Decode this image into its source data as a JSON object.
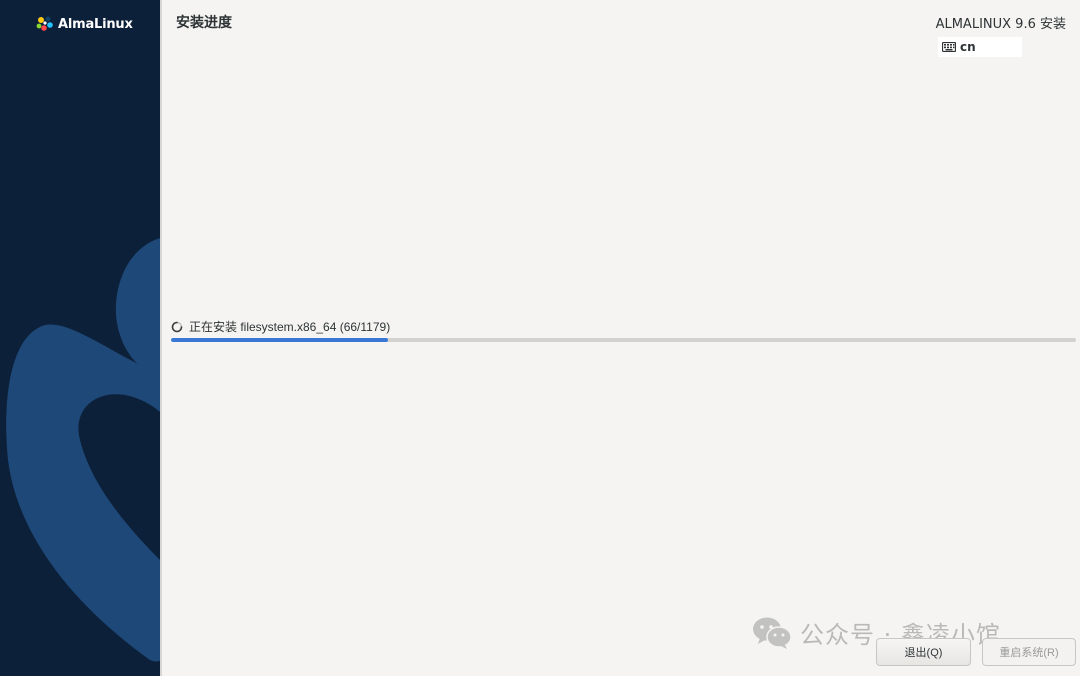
{
  "sidebar": {
    "logo_text": "AlmaLinux"
  },
  "header": {
    "page_title": "安装进度",
    "product_title": "ALMALINUX 9.6 安装",
    "keyboard_layout": "cn"
  },
  "progress": {
    "status_text": "正在安装 filesystem.x86_64 (66/1179)",
    "fraction": 0.24
  },
  "buttons": {
    "quit_label": "退出(Q)",
    "reboot_label": "重启系统(R)"
  },
  "watermark": {
    "text": "公众号 · 鑫凌小馆"
  },
  "colors": {
    "sidebar_bg": "#0c2039",
    "swirl": "#1e4877",
    "accent": "#3a78d6",
    "background": "#f5f4f2"
  },
  "icons": {
    "logo": "almalinux-logo-icon",
    "keyboard": "keyboard-icon",
    "spinner": "spinner-icon",
    "wechat": "wechat-icon"
  }
}
